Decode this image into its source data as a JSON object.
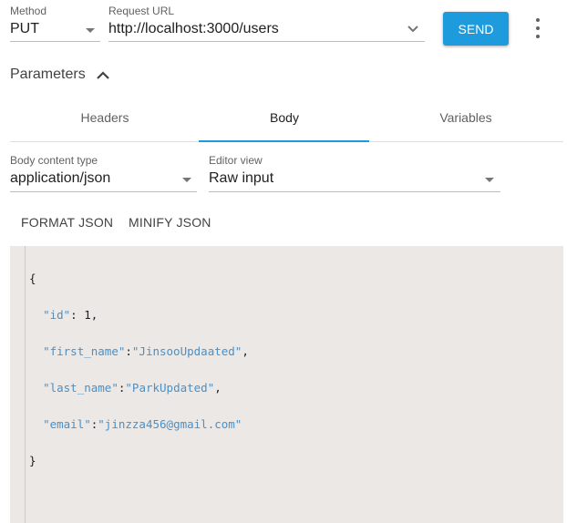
{
  "request": {
    "method_label": "Method",
    "method_value": "PUT",
    "url_label": "Request URL",
    "url_value": "http://localhost:3000/users",
    "send_label": "SEND"
  },
  "parameters": {
    "title": "Parameters"
  },
  "tabs": [
    {
      "label": "Headers",
      "active": false
    },
    {
      "label": "Body",
      "active": true
    },
    {
      "label": "Variables",
      "active": false
    }
  ],
  "body_settings": {
    "content_type_label": "Body content type",
    "content_type_value": "application/json",
    "editor_view_label": "Editor view",
    "editor_view_value": "Raw input"
  },
  "actions": {
    "format_label": "FORMAT JSON",
    "minify_label": "MINIFY JSON"
  },
  "editor": {
    "open_brace": "{",
    "close_brace": "}",
    "lines": [
      {
        "key": "\"id\"",
        "sep": ": ",
        "value": "1",
        "value_type": "number",
        "trail": ","
      },
      {
        "key": "\"first_name\"",
        "sep": ":",
        "value": "\"JinsooUpdaated\"",
        "value_type": "string",
        "trail": ","
      },
      {
        "key": "\"last_name\"",
        "sep": ":",
        "value": "\"ParkUpdated\"",
        "value_type": "string",
        "trail": ","
      },
      {
        "key": "\"email\"",
        "sep": ":",
        "value": "\"jinzza456@gmail.com\"",
        "value_type": "string",
        "trail": ""
      }
    ]
  },
  "colors": {
    "accent": "#1e9bdc",
    "editor_bg": "#ebe8e5",
    "json_key": "#4a90c8"
  }
}
